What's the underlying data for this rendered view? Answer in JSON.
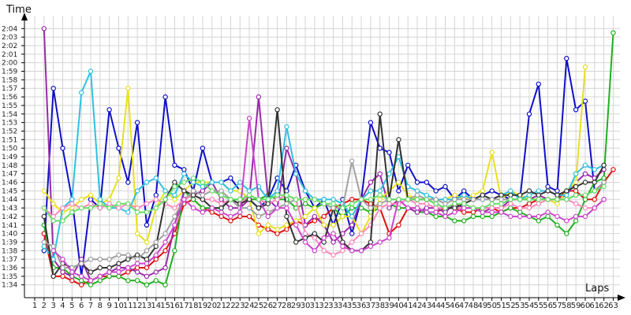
{
  "chart_data": {
    "type": "line",
    "xlabel": "Laps",
    "ylabel": "Time",
    "grid": true,
    "legend": "none",
    "x_ticks": [
      1,
      2,
      3,
      4,
      5,
      6,
      7,
      8,
      9,
      10,
      11,
      12,
      13,
      14,
      15,
      16,
      17,
      18,
      19,
      20,
      21,
      22,
      23,
      24,
      25,
      26,
      27,
      28,
      29,
      30,
      31,
      32,
      33,
      34,
      35,
      36,
      37,
      38,
      39,
      40,
      41,
      42,
      43,
      44,
      45,
      46,
      47,
      48,
      49,
      50,
      51,
      52,
      53,
      54,
      55,
      56,
      57,
      58,
      59,
      60,
      61,
      62,
      63
    ],
    "y_ticks_seconds": [
      94,
      95,
      96,
      97,
      98,
      99,
      100,
      101,
      102,
      103,
      104,
      105,
      106,
      107,
      108,
      109,
      110,
      111,
      112,
      113,
      114,
      115,
      116,
      117,
      118,
      119,
      120,
      121,
      122,
      123,
      124
    ],
    "y_tick_labels": [
      "1:34",
      "1:35",
      "1:36",
      "1:37",
      "1:38",
      "1:39",
      "1:40",
      "1:41",
      "1:42",
      "1:43",
      "1:44",
      "1:45",
      "1:46",
      "1:47",
      "1:48",
      "1:49",
      "1:50",
      "1:51",
      "1:52",
      "1:53",
      "1:54",
      "1:55",
      "1:56",
      "1:57",
      "1:58",
      "1:59",
      "2:00",
      "2:01",
      "2:02",
      "2:03",
      "2:04"
    ],
    "xlim": [
      1,
      63
    ],
    "ylim_seconds": [
      92.5,
      125.5
    ],
    "series": [
      {
        "color": "#1010c8",
        "values": [
          null,
          98.0,
          117.0,
          110.0,
          104.0,
          95.0,
          104.0,
          103.0,
          114.5,
          110.0,
          106.0,
          113.0,
          101.0,
          104.5,
          116.0,
          108.0,
          107.5,
          105.0,
          110.0,
          106.0,
          106.0,
          106.5,
          105.0,
          104.0,
          103.0,
          104.0,
          106.5,
          105.0,
          108.0,
          105.0,
          103.0,
          104.0,
          101.0,
          104.0,
          100.0,
          104.0,
          113.0,
          110.0,
          109.5,
          105.0,
          108.0,
          106.0,
          106.0,
          105.0,
          105.5,
          104.0,
          105.0,
          104.0,
          104.5,
          105.0,
          104.5,
          104.0,
          104.0,
          114.0,
          117.5,
          105.5,
          105.0,
          120.5,
          114.5,
          115.5,
          105.0,
          106.0,
          null
        ]
      },
      {
        "color": "#e01010",
        "values": [
          null,
          100.0,
          95.0,
          95.0,
          94.5,
          94.0,
          94.5,
          95.0,
          95.0,
          95.0,
          95.5,
          96.0,
          96.0,
          97.0,
          98.0,
          100.0,
          103.5,
          104.0,
          103.0,
          102.5,
          102.0,
          101.5,
          102.0,
          102.0,
          101.0,
          100.5,
          100.0,
          100.5,
          101.5,
          101.0,
          101.5,
          102.0,
          103.0,
          103.5,
          104.0,
          104.0,
          103.5,
          103.0,
          100.0,
          101.0,
          103.0,
          103.0,
          102.5,
          102.5,
          103.0,
          103.0,
          102.5,
          102.5,
          103.0,
          103.0,
          102.5,
          103.0,
          103.0,
          103.5,
          104.0,
          104.0,
          104.0,
          105.0,
          105.0,
          104.0,
          104.0,
          106.0,
          107.5
        ]
      },
      {
        "color": "#20b020",
        "values": [
          null,
          101.0,
          96.0,
          96.0,
          95.0,
          94.5,
          94.0,
          94.5,
          95.0,
          95.0,
          94.5,
          94.5,
          94.0,
          94.5,
          94.0,
          98.0,
          105.0,
          104.0,
          103.0,
          103.0,
          103.0,
          104.0,
          104.0,
          104.0,
          104.0,
          104.5,
          104.0,
          104.0,
          103.0,
          103.5,
          103.0,
          103.5,
          103.0,
          102.0,
          103.0,
          103.0,
          102.5,
          103.0,
          103.5,
          103.0,
          103.0,
          102.5,
          102.5,
          102.0,
          102.0,
          101.5,
          101.5,
          102.0,
          102.0,
          102.0,
          102.5,
          103.0,
          102.5,
          102.0,
          101.5,
          102.0,
          101.0,
          100.0,
          101.5,
          104.0,
          106.0,
          106.5,
          123.5
        ]
      },
      {
        "color": "#9a2aaa",
        "values": [
          null,
          124.0,
          97.0,
          95.5,
          95.0,
          97.0,
          94.5,
          95.0,
          95.5,
          96.0,
          96.0,
          95.5,
          95.0,
          95.5,
          96.0,
          101.0,
          105.0,
          104.5,
          105.0,
          106.0,
          104.0,
          103.0,
          103.0,
          104.0,
          116.0,
          104.0,
          103.0,
          110.0,
          107.0,
          101.0,
          102.0,
          101.0,
          99.0,
          100.0,
          101.0,
          104.0,
          106.0,
          107.0,
          103.0,
          104.0,
          103.0,
          102.5,
          103.0,
          103.0,
          102.5,
          103.5,
          103.0,
          103.0,
          102.5,
          103.0,
          103.0,
          104.0,
          104.0,
          104.0,
          104.5,
          104.0,
          104.0,
          104.5,
          106.0,
          107.0,
          106.5,
          107.5,
          null
        ]
      },
      {
        "color": "#e8e020",
        "values": [
          null,
          105.0,
          103.5,
          102.5,
          103.0,
          104.0,
          104.5,
          103.5,
          104.0,
          106.5,
          117.0,
          100.0,
          99.0,
          103.0,
          105.0,
          104.0,
          105.0,
          106.0,
          106.0,
          106.0,
          106.0,
          105.0,
          105.0,
          104.0,
          100.0,
          101.0,
          100.5,
          101.0,
          101.5,
          102.0,
          103.0,
          101.0,
          101.0,
          102.0,
          102.0,
          100.0,
          102.0,
          104.0,
          105.0,
          106.0,
          104.5,
          104.0,
          104.0,
          104.0,
          104.0,
          104.5,
          104.0,
          104.5,
          105.0,
          109.5,
          104.0,
          105.0,
          104.5,
          104.0,
          104.0,
          104.0,
          103.5,
          105.0,
          106.0,
          119.5,
          null,
          null,
          null
        ]
      },
      {
        "color": "#30c0e0",
        "values": [
          null,
          98.5,
          97.0,
          103.0,
          104.0,
          116.5,
          119.0,
          104.0,
          103.0,
          103.0,
          102.5,
          105.0,
          106.0,
          106.5,
          105.0,
          104.5,
          107.0,
          106.0,
          105.5,
          106.0,
          106.0,
          105.0,
          106.0,
          105.0,
          105.5,
          104.0,
          105.0,
          112.5,
          107.0,
          105.0,
          104.0,
          104.0,
          104.0,
          103.5,
          102.0,
          104.0,
          105.0,
          105.0,
          107.0,
          109.0,
          105.5,
          105.0,
          104.5,
          104.0,
          104.0,
          104.0,
          104.5,
          104.0,
          104.0,
          104.0,
          104.5,
          105.0,
          104.0,
          104.5,
          105.0,
          105.0,
          104.5,
          104.5,
          107.0,
          108.0,
          107.5,
          108.0,
          null
        ]
      },
      {
        "color": "#ff88bb",
        "values": [
          null,
          103.0,
          102.0,
          103.0,
          103.5,
          103.0,
          103.5,
          103.0,
          103.5,
          103.0,
          103.5,
          103.0,
          103.5,
          104.0,
          103.5,
          103.0,
          104.0,
          104.5,
          104.0,
          104.0,
          103.5,
          104.0,
          103.5,
          104.5,
          104.0,
          103.5,
          104.0,
          104.5,
          104.0,
          100.0,
          99.5,
          98.0,
          97.5,
          98.0,
          99.0,
          100.0,
          101.0,
          103.0,
          103.5,
          103.5,
          104.0,
          103.5,
          103.5,
          103.0,
          103.0,
          103.0,
          103.0,
          103.0,
          103.0,
          103.0,
          103.0,
          103.5,
          103.0,
          103.0,
          103.5,
          104.0,
          104.0,
          104.0,
          103.5,
          103.0,
          103.0,
          104.0,
          null
        ]
      },
      {
        "color": "#333333",
        "values": [
          null,
          102.0,
          95.0,
          96.5,
          96.0,
          96.5,
          95.5,
          96.0,
          96.0,
          96.5,
          97.0,
          97.5,
          97.0,
          98.5,
          104.0,
          106.0,
          105.0,
          104.5,
          104.0,
          103.0,
          103.0,
          104.0,
          103.5,
          104.0,
          103.0,
          103.5,
          114.5,
          102.0,
          99.0,
          99.5,
          100.0,
          99.0,
          103.0,
          99.0,
          98.0,
          98.0,
          99.0,
          114.0,
          104.0,
          111.0,
          104.0,
          104.0,
          104.0,
          103.5,
          103.0,
          103.0,
          103.5,
          104.0,
          104.5,
          104.0,
          104.5,
          104.5,
          104.5,
          105.0,
          104.5,
          105.0,
          104.5,
          105.0,
          105.5,
          106.0,
          106.0,
          108.0,
          null
        ]
      },
      {
        "color": "#a0a0a0",
        "values": [
          null,
          99.0,
          98.5,
          96.0,
          96.0,
          96.5,
          97.0,
          97.0,
          97.0,
          97.5,
          97.5,
          97.0,
          98.0,
          99.0,
          100.0,
          102.0,
          104.0,
          105.0,
          104.5,
          105.0,
          105.0,
          104.0,
          103.0,
          103.0,
          102.0,
          102.5,
          103.0,
          103.5,
          104.0,
          104.0,
          104.0,
          103.5,
          103.0,
          103.0,
          108.5,
          104.0,
          103.0,
          103.5,
          104.0,
          104.0,
          104.0,
          104.5,
          104.0,
          104.0,
          103.5,
          104.0,
          104.0,
          104.0,
          104.0,
          104.0,
          104.0,
          104.0,
          104.0,
          104.0,
          104.0,
          104.0,
          104.0,
          104.0,
          104.5,
          104.5,
          105.0,
          106.0,
          null
        ]
      },
      {
        "color": "#cc44cc",
        "values": [
          null,
          null,
          98.0,
          97.0,
          95.5,
          95.0,
          94.5,
          95.0,
          95.5,
          95.5,
          96.0,
          96.5,
          96.5,
          97.5,
          99.0,
          101.0,
          104.0,
          103.0,
          102.5,
          103.0,
          102.5,
          102.0,
          102.5,
          113.5,
          104.0,
          102.0,
          103.0,
          103.0,
          101.0,
          99.0,
          98.0,
          99.5,
          100.0,
          98.5,
          98.0,
          98.0,
          98.5,
          99.0,
          99.5,
          104.0,
          103.0,
          103.0,
          102.5,
          102.5,
          102.0,
          102.5,
          103.0,
          103.0,
          102.5,
          102.5,
          102.5,
          102.0,
          102.0,
          102.0,
          102.0,
          102.5,
          102.0,
          101.5,
          102.0,
          102.0,
          103.0,
          104.0,
          null
        ]
      },
      {
        "color": "#66dd66",
        "values": [
          null,
          103.0,
          101.5,
          101.5,
          102.5,
          103.0,
          103.0,
          103.5,
          103.0,
          103.5,
          103.5,
          102.5,
          102.5,
          103.0,
          104.0,
          105.5,
          106.0,
          106.5,
          106.0,
          105.0,
          104.5,
          104.0,
          104.0,
          104.5,
          104.0,
          104.0,
          104.5,
          104.5,
          104.0,
          104.0,
          104.0,
          103.5,
          103.5,
          103.0,
          103.5,
          104.0,
          104.0,
          104.5,
          104.0,
          104.0,
          104.0,
          104.0,
          104.0,
          103.5,
          103.0,
          103.5,
          103.5,
          103.0,
          103.0,
          103.5,
          103.5,
          104.0,
          104.0,
          104.0,
          104.0,
          104.0,
          104.0,
          104.0,
          104.5,
          104.5,
          105.0,
          105.5,
          null
        ]
      }
    ]
  }
}
